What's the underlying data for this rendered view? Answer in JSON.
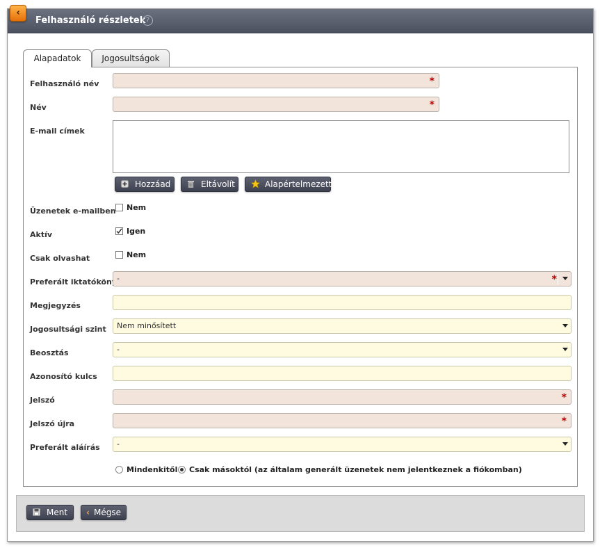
{
  "window": {
    "title": "Felhasználó részletek"
  },
  "tabs": [
    {
      "label": "Alapadatok",
      "active": true
    },
    {
      "label": "Jogosultságok",
      "active": false
    }
  ],
  "form": {
    "felhasznalo_nev": {
      "label": "Felhasználó név",
      "value": "",
      "required": true
    },
    "nev": {
      "label": "Név",
      "value": "",
      "required": true
    },
    "email": {
      "label": "E-mail címek",
      "value": ""
    },
    "email_buttons": {
      "add": "Hozzáad",
      "remove": "Eltávolít",
      "default": "Alapértelmezett"
    },
    "uzenetek_emailben": {
      "label": "Üzenetek e-mailben",
      "checked": false,
      "text": "Nem"
    },
    "aktiv": {
      "label": "Aktív",
      "checked": true,
      "text": "Igen"
    },
    "csak_olvashat": {
      "label": "Csak olvashat",
      "checked": false,
      "text": "Nem"
    },
    "preferalt_iktatokonyv": {
      "label": "Preferált iktatókönyv",
      "value": "-",
      "required": true
    },
    "megjegyzes": {
      "label": "Megjegyzés",
      "value": ""
    },
    "jogosultsagi_szint": {
      "label": "Jogosultsági szint",
      "value": "Nem minősített"
    },
    "beosztas": {
      "label": "Beosztás",
      "value": "-"
    },
    "azonosito_kulcs": {
      "label": "Azonosító kulcs",
      "value": ""
    },
    "jelszo": {
      "label": "Jelszó",
      "value": "",
      "required": true
    },
    "jelszo_ujra": {
      "label": "Jelszó újra",
      "value": "",
      "required": true
    },
    "preferalt_alairas": {
      "label": "Preferált aláírás",
      "value": "-"
    },
    "message_source": {
      "options": [
        {
          "label": "Mindenkitől",
          "selected": false
        },
        {
          "label": "Csak másoktól (az általam generált üzenetek nem jelentkeznek a fiókomban)",
          "selected": true
        }
      ]
    }
  },
  "footer": {
    "save": "Ment",
    "cancel": "Mégse"
  },
  "colors": {
    "required_bg": "#f2e4da",
    "optional_bg": "#fefbe0",
    "required_star": "#c00000",
    "titlebar": "#5a5f6d",
    "accent": "#f08a1e"
  }
}
